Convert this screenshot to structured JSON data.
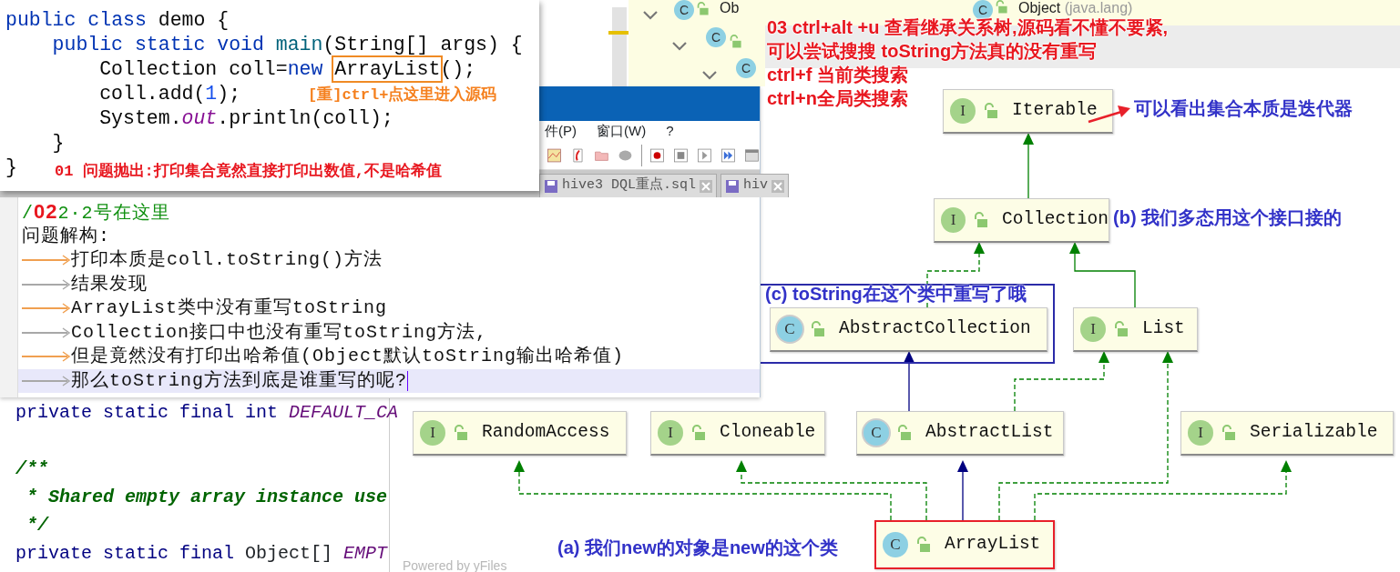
{
  "code_window": {
    "lines": [
      [
        {
          "text": "public",
          "kind": "kw"
        },
        {
          "text": " class",
          "kind": "kw"
        },
        {
          "text": " demo {",
          "kind": "plain"
        }
      ],
      [
        {
          "text": "    public",
          "kind": "kw"
        },
        {
          "text": " static",
          "kind": "kw"
        },
        {
          "text": " void",
          "kind": "kw"
        },
        {
          "text": " main",
          "kind": "method"
        },
        {
          "text": "(String[] args) {",
          "kind": "plain"
        }
      ],
      [
        {
          "text": "        Collection coll=",
          "kind": "plain"
        },
        {
          "text": "new ",
          "kind": "kw"
        },
        {
          "text": "ArrayList",
          "kind": "boxed"
        },
        {
          "text": "();",
          "kind": "plain"
        }
      ],
      [
        {
          "text": "        coll.add(",
          "kind": "plain"
        },
        {
          "text": "1",
          "kind": "num"
        },
        {
          "text": ");",
          "kind": "plain"
        }
      ],
      [
        {
          "text": "        System.",
          "kind": "plain"
        },
        {
          "text": "out",
          "kind": "field"
        },
        {
          "text": ".println(coll);",
          "kind": "plain"
        }
      ],
      [
        {
          "text": "    }",
          "kind": "plain"
        }
      ],
      [
        {
          "text": "}",
          "kind": "plain"
        }
      ]
    ],
    "notes": [
      {
        "text": "[重]ctrl+点这里进入源码",
        "kind": "tip"
      },
      {
        "text": "01 问题抛出:打印集合竟然直接打印出数值,不是哈希值",
        "kind": "problem"
      }
    ]
  },
  "notepad": {
    "menu": [
      "件(P)",
      "窗口(W)",
      "?"
    ],
    "tabs": [
      {
        "label": "hive3 DQL重点.sql"
      },
      {
        "label": "hiv"
      }
    ],
    "lines": [
      {
        "segments": [
          {
            "text": "/",
            "kind": "comment"
          },
          {
            "text": "02",
            "kind": "badge"
          },
          {
            "text": "2·2号在这里",
            "kind": "comment"
          }
        ],
        "current": false
      },
      {
        "segments": [
          {
            "text": "问题解构:",
            "kind": "body"
          }
        ],
        "current": false
      },
      {
        "color": "#f0a050",
        "segments": [
          {
            "text": "打印本质是coll.toString()方法",
            "kind": "body"
          }
        ],
        "current": false
      },
      {
        "color": "#a8a8a8",
        "segments": [
          {
            "text": "结果发现",
            "kind": "body"
          }
        ],
        "current": false
      },
      {
        "color": "#f0a050",
        "segments": [
          {
            "text": "ArrayList类中没有重写toString",
            "kind": "body"
          }
        ],
        "current": false
      },
      {
        "color": "#a8a8a8",
        "segments": [
          {
            "text": "Collection接口中也没有重写toString方法,",
            "kind": "body"
          }
        ],
        "current": false
      },
      {
        "color": "#f0a050",
        "segments": [
          {
            "text": "但是竟然没有打印出哈希值(Object默认toString输出哈希值)",
            "kind": "body"
          }
        ],
        "current": false
      },
      {
        "color": "#a8a8a8",
        "segments": [
          {
            "text": "那么toString方法到底是谁重写的呢?",
            "kind": "body"
          }
        ],
        "current": true
      }
    ]
  },
  "source_code": {
    "lines": [
      {
        "kind": "code",
        "tokens": [
          {
            "text": "private static final int",
            "kind": "kw"
          },
          {
            "text": " DEFAULT_CA",
            "kind": "const"
          }
        ]
      },
      {
        "kind": "blank"
      },
      {
        "kind": "code",
        "tokens": [
          {
            "text": "/**",
            "kind": "doc"
          }
        ]
      },
      {
        "kind": "code",
        "tokens": [
          {
            "text": " * Shared empty array instance use",
            "kind": "doc"
          }
        ]
      },
      {
        "kind": "code",
        "tokens": [
          {
            "text": " */",
            "kind": "doc"
          }
        ]
      },
      {
        "kind": "code",
        "tokens": [
          {
            "text": "private static final",
            "kind": "kw"
          },
          {
            "text": " Object[] ",
            "kind": "plain"
          },
          {
            "text": "EMPT",
            "kind": "const"
          }
        ]
      }
    ]
  },
  "hierarchy_panel": {
    "items": [
      {
        "badge": "C",
        "name": "Ob"
      },
      {
        "badge": "C"
      },
      {
        "badge": "C"
      },
      {
        "badge": "C",
        "name": "Object",
        "package": "(java.lang)"
      }
    ]
  },
  "diagram": {
    "nodes": [
      {
        "name": "Iterable",
        "badge": "I",
        "kind": "interface",
        "selected": false
      },
      {
        "name": "Collection",
        "badge": "I",
        "kind": "interface",
        "selected": false
      },
      {
        "name": "AbstractCollection",
        "badge": "C",
        "kind": "abstract_class",
        "selected": false
      },
      {
        "name": "List",
        "badge": "I",
        "kind": "interface",
        "selected": false
      },
      {
        "name": "RandomAccess",
        "badge": "I",
        "kind": "interface",
        "selected": false
      },
      {
        "name": "Cloneable",
        "badge": "I",
        "kind": "interface",
        "selected": false
      },
      {
        "name": "AbstractList",
        "badge": "C",
        "kind": "abstract_class",
        "selected": false
      },
      {
        "name": "Serializable",
        "badge": "I",
        "kind": "interface",
        "selected": false
      },
      {
        "name": "ArrayList",
        "badge": "C",
        "kind": "class",
        "selected": true
      }
    ],
    "edges": [
      {
        "kind": "extends",
        "color": "#008000"
      },
      {
        "kind": "implements",
        "color": "#008000"
      },
      {
        "kind": "extends",
        "color": "#008000"
      },
      {
        "kind": "extends",
        "color": "#000080"
      },
      {
        "kind": "implements",
        "color": "#008000"
      },
      {
        "kind": "implements",
        "color": "#008000"
      },
      {
        "kind": "implements",
        "color": "#008000"
      },
      {
        "kind": "extends",
        "color": "#000080"
      },
      {
        "kind": "implements",
        "color": "#008000"
      },
      {
        "kind": "implements",
        "color": "#008000"
      }
    ],
    "footer": "Powered by yFiles"
  },
  "annotations": [
    {
      "text": "03 ctrl+alt +u 查看继承关系树,源码看不懂不要紧,",
      "kind": "step"
    },
    {
      "text": "可以尝试搜搜 toString方法真的没有重写",
      "kind": "step"
    },
    {
      "text": "ctrl+f 当前类搜索",
      "kind": "step"
    },
    {
      "text": "ctrl+n全局类搜索",
      "kind": "step"
    },
    {
      "text": "可以看出集合本质是迭代器",
      "kind": "note"
    },
    {
      "text": "(b) 我们多态用这个接口接的",
      "kind": "note"
    },
    {
      "text": "(c) toString在这个类中重写了哦",
      "kind": "note"
    },
    {
      "text": "(a) 我们new的对象是new的这个类",
      "kind": "note"
    }
  ]
}
